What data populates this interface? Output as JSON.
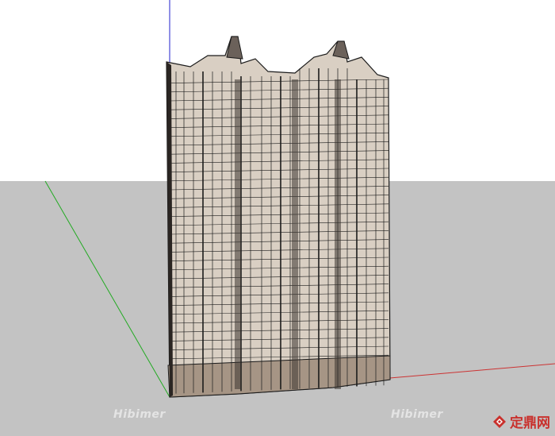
{
  "colors": {
    "sky": "#ffffff",
    "ground": "#c3c3c3",
    "facade": "#d9cfc3",
    "outline": "#1b1b1b",
    "axis_blue": "#2222cc",
    "axis_green": "#22aa22",
    "axis_red": "#cc3333",
    "logo_red": "#c9302c"
  },
  "watermarks": {
    "left_mid": "Hibimer",
    "right_mid": "Hibimer",
    "bottom_left": "Hibimer",
    "bottom_right": "Hibimer"
  },
  "logo": {
    "text": "定鼎网",
    "icon": "diamond-logo-icon"
  },
  "scene": {
    "subject": "high-rise residential tower model",
    "towers": 2,
    "floors_visible": 32
  }
}
